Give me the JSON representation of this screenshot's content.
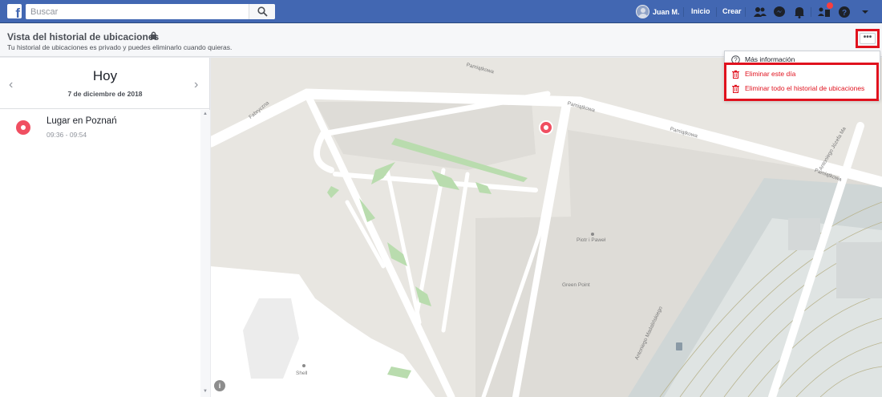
{
  "topbar": {
    "search_placeholder": "Buscar",
    "user_name": "Juan M.",
    "home_label": "Inicio",
    "create_label": "Crear"
  },
  "header": {
    "title": "Vista del historial de ubicaciones",
    "subtitle": "Tu historial de ubicaciones es privado y puedes eliminarlo cuando quieras.",
    "more_label": "•••"
  },
  "dropdown": {
    "items": [
      {
        "label": "Más información",
        "icon": "question-icon"
      },
      {
        "label": "Eliminar este día",
        "icon": "trash-icon"
      },
      {
        "label": "Eliminar todo el historial de ubicaciones",
        "icon": "trash-icon"
      }
    ]
  },
  "day": {
    "title": "Hoy",
    "date": "7 de diciembre de 2018"
  },
  "places": [
    {
      "name": "Lugar en Poznań",
      "time": "09:36 - 09:54"
    }
  ],
  "map": {
    "streets": [
      "Pamiątkowa",
      "Pamiątkowa",
      "Pamiątkowa",
      "Pamiątkowa",
      "Fabryczna",
      "Antoniego Józefa Ma",
      "Antoniego Madalińskiego"
    ],
    "pois": [
      "Piotr i Paweł",
      "Green Point",
      "Shell"
    ],
    "info_label": "i"
  },
  "colors": {
    "brand": "#4267b2",
    "highlight": "#e0121e",
    "pin": "#f04f61"
  }
}
